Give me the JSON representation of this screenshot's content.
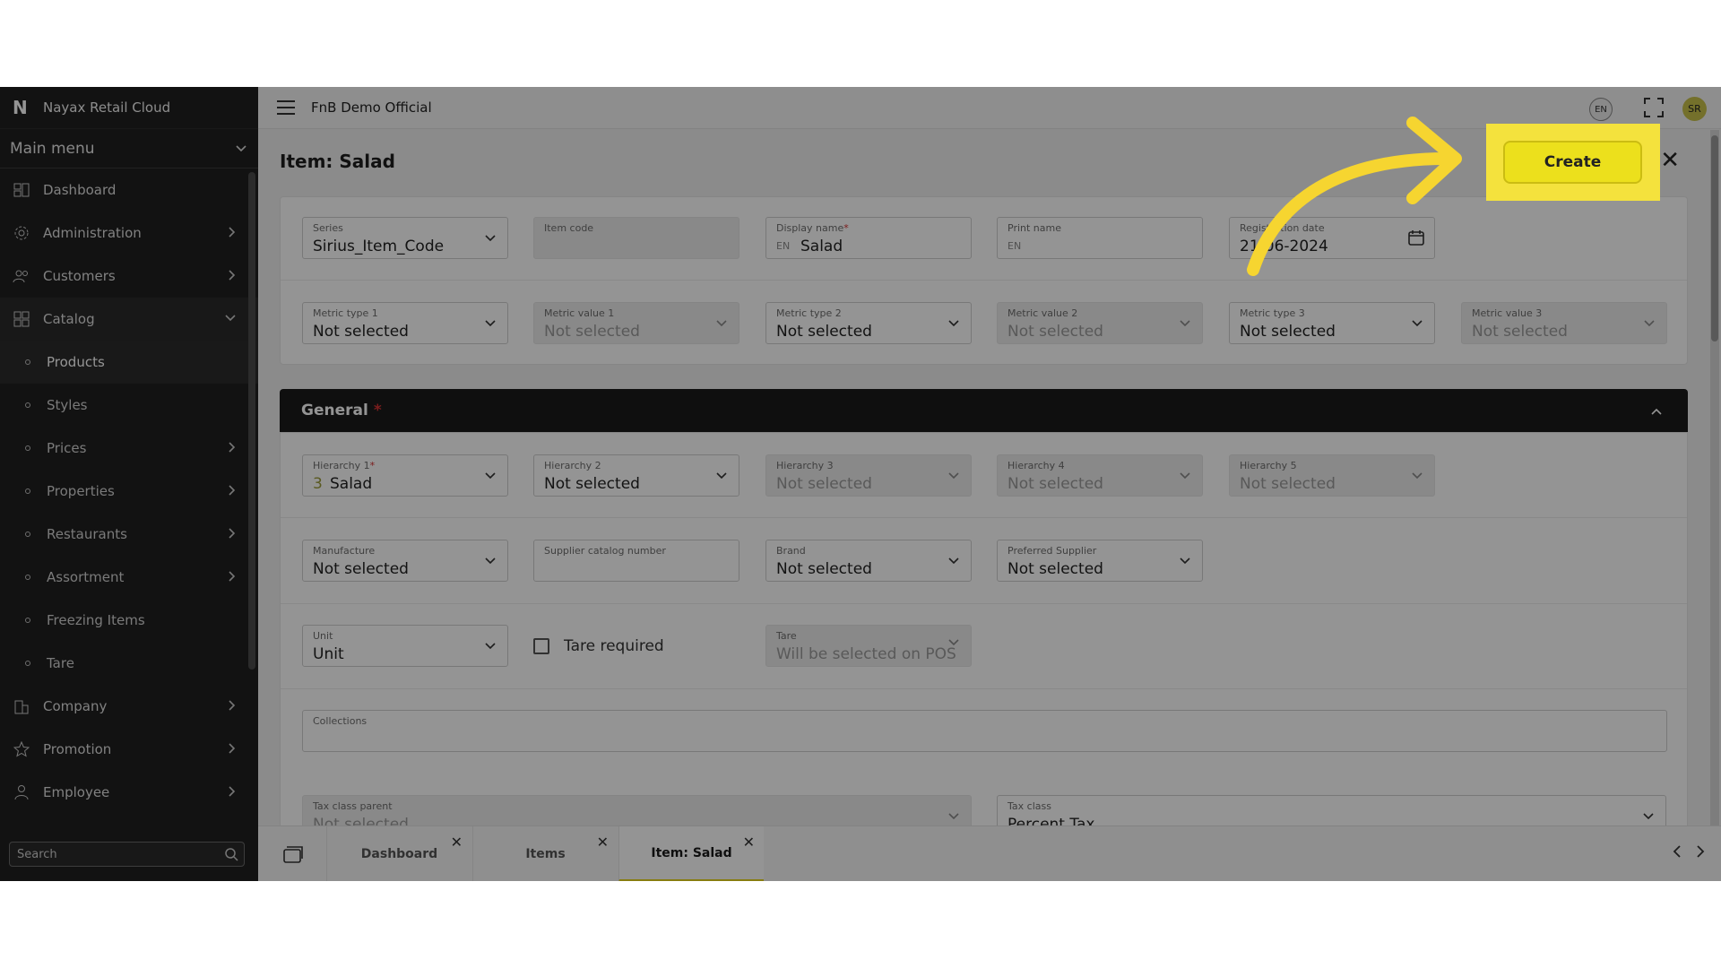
{
  "app": {
    "name": "Nayax Retail Cloud"
  },
  "sidebar": {
    "menu_title": "Main menu",
    "items": [
      {
        "label": "Dashboard"
      },
      {
        "label": "Administration"
      },
      {
        "label": "Customers"
      },
      {
        "label": "Catalog"
      }
    ],
    "catalog_children": [
      {
        "label": "Products"
      },
      {
        "label": "Styles"
      },
      {
        "label": "Prices"
      },
      {
        "label": "Properties"
      },
      {
        "label": "Restaurants"
      },
      {
        "label": "Assortment"
      },
      {
        "label": "Freezing Items"
      },
      {
        "label": "Tare"
      }
    ],
    "items_after": [
      {
        "label": "Company"
      },
      {
        "label": "Promotion"
      },
      {
        "label": "Employee"
      }
    ],
    "search_placeholder": "Search"
  },
  "topbar": {
    "org": "FnB Demo Official",
    "lang": "EN",
    "avatar": "SR"
  },
  "page": {
    "title": "Item: Salad",
    "create_label": "Create"
  },
  "top_fields": {
    "series": {
      "label": "Series",
      "value": "Sirius_Item_Code"
    },
    "item_code": {
      "label": "Item code",
      "value": ""
    },
    "display_name": {
      "label": "Display name",
      "lang": "EN",
      "value": "Salad"
    },
    "print_name": {
      "label": "Print name",
      "lang": "EN",
      "value": ""
    },
    "registration_date": {
      "label": "Registration date",
      "value": "21-06-2024"
    },
    "metric_type_1": {
      "label": "Metric type 1",
      "value": "Not selected"
    },
    "metric_value_1": {
      "label": "Metric value 1",
      "value": "Not selected"
    },
    "metric_type_2": {
      "label": "Metric type 2",
      "value": "Not selected"
    },
    "metric_value_2": {
      "label": "Metric value 2",
      "value": "Not selected"
    },
    "metric_type_3": {
      "label": "Metric type 3",
      "value": "Not selected"
    },
    "metric_value_3": {
      "label": "Metric value 3",
      "value": "Not selected"
    }
  },
  "general": {
    "title": "General",
    "hierarchy_1": {
      "label": "Hierarchy 1",
      "code": "3",
      "value": "Salad"
    },
    "hierarchy_2": {
      "label": "Hierarchy 2",
      "value": "Not selected"
    },
    "hierarchy_3": {
      "label": "Hierarchy 3",
      "value": "Not selected"
    },
    "hierarchy_4": {
      "label": "Hierarchy 4",
      "value": "Not selected"
    },
    "hierarchy_5": {
      "label": "Hierarchy 5",
      "value": "Not selected"
    },
    "manufacture": {
      "label": "Manufacture",
      "value": "Not selected"
    },
    "supplier_catalog": {
      "label": "Supplier catalog number",
      "value": ""
    },
    "brand": {
      "label": "Brand",
      "value": "Not selected"
    },
    "preferred_supplier": {
      "label": "Preferred Supplier",
      "value": "Not selected"
    },
    "unit": {
      "label": "Unit",
      "value": "Unit"
    },
    "tare_required": {
      "label": "Tare required"
    },
    "tare": {
      "label": "Tare",
      "value": "Will be selected on POS"
    },
    "collections": {
      "label": "Collections"
    },
    "tax_class_parent": {
      "label": "Tax class parent",
      "value": "Not selected"
    },
    "tax_class": {
      "label": "Tax class",
      "value": "Percent Tax"
    }
  },
  "tabs": [
    {
      "label": "Dashboard"
    },
    {
      "label": "Items"
    },
    {
      "label": "Item: Salad"
    }
  ],
  "colors": {
    "accent": "#ece01c",
    "sidebar": "#1f1f1f"
  }
}
